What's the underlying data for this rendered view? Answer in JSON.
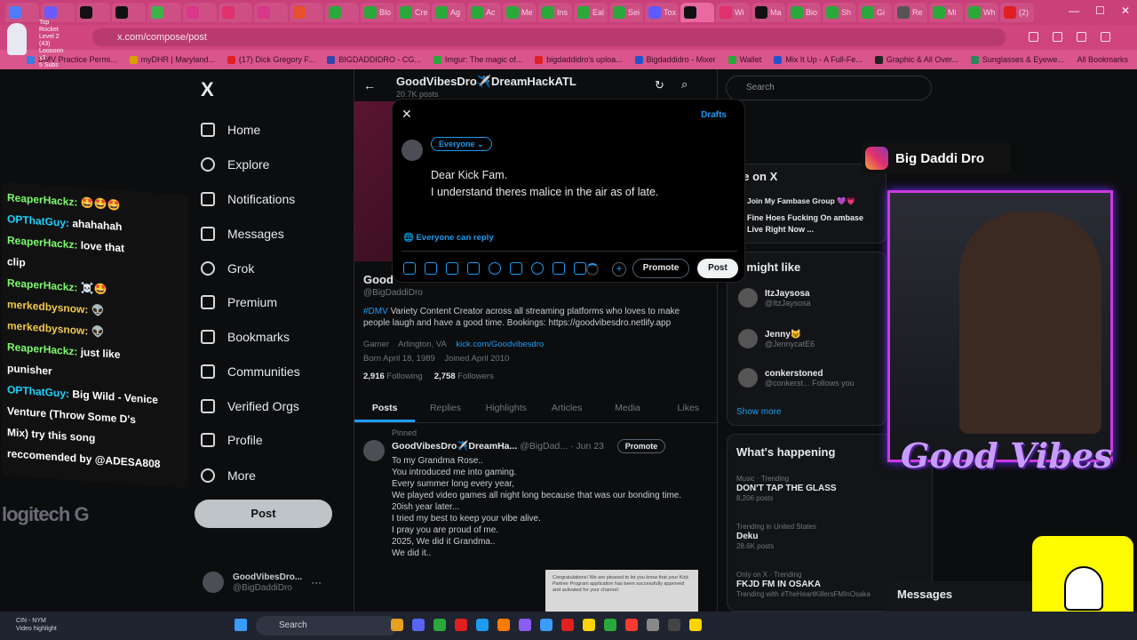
{
  "browser": {
    "tabs": [
      {
        "label": "",
        "color": "#4f7cff"
      },
      {
        "label": "",
        "color": "#6b5bff"
      },
      {
        "label": "",
        "color": "#111"
      },
      {
        "label": "",
        "color": "#111"
      },
      {
        "label": "",
        "color": "#3fb24a"
      },
      {
        "label": "",
        "color": "#d8378a"
      },
      {
        "label": "",
        "color": "#e0306d"
      },
      {
        "label": "",
        "color": "#d8378a"
      },
      {
        "label": "",
        "color": "#e8502c"
      },
      {
        "label": "",
        "color": "#2aa83a"
      },
      {
        "label": "Blo",
        "color": "#2aa83a"
      },
      {
        "label": "Cre",
        "color": "#2aa83a"
      },
      {
        "label": "Ag",
        "color": "#2aa83a"
      },
      {
        "label": "Ac",
        "color": "#2aa83a"
      },
      {
        "label": "Me",
        "color": "#2aa83a"
      },
      {
        "label": "Ins",
        "color": "#2aa83a"
      },
      {
        "label": "Eal",
        "color": "#2aa83a"
      },
      {
        "label": "Sei",
        "color": "#2aa83a"
      },
      {
        "label": "Tox",
        "color": "#5b5bff"
      },
      {
        "label": "",
        "color": "#111"
      },
      {
        "label": "Wi",
        "color": "#e0306d"
      },
      {
        "label": "Ma",
        "color": "#111"
      },
      {
        "label": "Bio",
        "color": "#2aa83a"
      },
      {
        "label": "Sh",
        "color": "#2aa83a"
      },
      {
        "label": "Gi",
        "color": "#2aa83a"
      },
      {
        "label": "Re",
        "color": "#555"
      },
      {
        "label": "Mi",
        "color": "#2aa83a"
      },
      {
        "label": "Wh",
        "color": "#2aa83a"
      },
      {
        "label": "(2)",
        "color": "#e02020"
      }
    ],
    "url": "x.com/compose/post",
    "bookmarks": [
      {
        "label": "DMV Practice Permi...",
        "color": "#3b7ddd"
      },
      {
        "label": "myDHR | Maryland...",
        "color": "#d9a000"
      },
      {
        "label": "(17) Dick Gregory F...",
        "color": "#e02020"
      },
      {
        "label": "BIGDADDIDRO - CG...",
        "color": "#3344aa"
      },
      {
        "label": "Imgur: The magic of...",
        "color": "#2aa83a"
      },
      {
        "label": "bigdaddidro's uploa...",
        "color": "#e02020"
      },
      {
        "label": "Bigdaddidro - Mixer",
        "color": "#2255cc"
      },
      {
        "label": "Wallet",
        "color": "#2aa83a"
      },
      {
        "label": "Mix It Up - A Full-Fe...",
        "color": "#2255cc"
      },
      {
        "label": "Graphic & All Over...",
        "color": "#222"
      },
      {
        "label": "Sunglasses & Eyewe...",
        "color": "#2a8a5a"
      }
    ],
    "all_bookmarks": "All Bookmarks",
    "rocket_overlay": [
      "Top Rocket",
      "Level 2 (43)",
      "Looooon x3",
      "5 Subs"
    ]
  },
  "x_nav": {
    "logo": "X",
    "items": [
      {
        "label": "Home",
        "icon": "home-icon"
      },
      {
        "label": "Explore",
        "icon": "search-icon"
      },
      {
        "label": "Notifications",
        "icon": "bell-icon"
      },
      {
        "label": "Messages",
        "icon": "mail-icon"
      },
      {
        "label": "Grok",
        "icon": "grok-icon"
      },
      {
        "label": "Premium",
        "icon": "x-premium-icon"
      },
      {
        "label": "Bookmarks",
        "icon": "bookmark-icon"
      },
      {
        "label": "Communities",
        "icon": "people-icon"
      },
      {
        "label": "Verified Orgs",
        "icon": "lightning-icon"
      },
      {
        "label": "Profile",
        "icon": "user-icon"
      },
      {
        "label": "More",
        "icon": "more-circle-icon"
      }
    ],
    "post_button": "Post",
    "account": {
      "name": "GoodVibesDro...",
      "handle": "@BigDaddiDro"
    }
  },
  "profile": {
    "title": "GoodVibesDro✈️DreamHackATL",
    "post_count": "20.7K posts",
    "name": "Good",
    "handle": "@BigDaddiDro",
    "bio_tag": "#DMV",
    "bio": " Variety Content Creator across all streaming platforms who loves to make people laugh and have a good time. Bookings: https://goodvibesdro.netlify.app",
    "category": "Gamer",
    "location": "Arlington, VA",
    "link": "kick.com/Goodvibesdro",
    "born": "Born April 18, 1989",
    "joined": "Joined April 2010",
    "following_count": "2,916",
    "following_label": "Following",
    "followers_count": "2,758",
    "followers_label": "Followers",
    "tabs": [
      "Posts",
      "Replies",
      "Highlights",
      "Articles",
      "Media",
      "Likes"
    ],
    "pinned": "Pinned",
    "tweet": {
      "name": "GoodVibesDro✈️DreamHa...",
      "meta": "@BigDad... · Jun 23",
      "promote": "Promote",
      "text": "To my Grandma Rose..\nYou introduced me into gaming.\nEvery summer long every year,\nWe played video games all night long because that was our bonding time.\n20ish year later...\nI tried my best to keep your vibe alive.\nI pray you are proud of me.\n2025, We did it Grandma..\nWe did it..",
      "media_text": "Congratulations! We are pleased to let you know that your Kick Partner Program application has been successfully approved and activated for your channel."
    }
  },
  "right": {
    "search_placeholder": "Search",
    "live_title": "ve on X",
    "live_item_1": "Join My Fambase Group 💜💗",
    "live_item_2": "Fine Hoes Fucking On ambase Live Right Now ...",
    "might_like": "u might like",
    "suggestions": [
      {
        "name": "ItzJaysosa",
        "handle": "@ItzJaysosa"
      },
      {
        "name": "Jenny😺",
        "handle": "@JennycatE6"
      },
      {
        "name": "conkerstoned",
        "handle": "@conkerst... Follows you"
      }
    ],
    "show_more": "Show more",
    "whats_happening": "What's happening",
    "trends": [
      {
        "cat": "Music · Trending",
        "name": "DON'T TAP THE GLASS",
        "count": "8,206 posts"
      },
      {
        "cat": "Trending in United States",
        "name": "Deku",
        "count": "28.6K posts"
      },
      {
        "cat": "Only on X · Trending",
        "name": "FKJD FM IN OSAKA",
        "count": "Trending with #TheHeartKillersFMInOsaka"
      }
    ],
    "messages": "Messages"
  },
  "compose": {
    "close": "✕",
    "drafts": "Drafts",
    "audience": "Everyone ⌄",
    "text_line1": "Dear Kick Fam.",
    "text_line2": "I understand theres malice in the air as of late.",
    "reply_setting": "Everyone can reply",
    "promote": "Promote",
    "post": "Post",
    "tools": [
      "image-icon",
      "gif-icon",
      "grok-icon",
      "poll-icon",
      "emoji-icon",
      "schedule-icon",
      "location-icon",
      "bold-icon",
      "italic-icon"
    ]
  },
  "stream": {
    "chat": [
      {
        "user": "ReaperHackz:",
        "msg": " 🤩🤩🤩",
        "color": "#7dfc6e"
      },
      {
        "user": "OPThatGuy:",
        "msg": " ahahahah",
        "color": "#1bd2ff"
      },
      {
        "user": "ReaperHackz:",
        "msg": " love that",
        "color": "#7dfc6e"
      },
      {
        "user": "",
        "msg": "clip",
        "color": "#fff"
      },
      {
        "user": "ReaperHackz:",
        "msg": " ☠️🤩",
        "color": "#7dfc6e"
      },
      {
        "user": "merkedbysnow:",
        "msg": " 👽",
        "color": "#f2c94c"
      },
      {
        "user": "merkedbysnow:",
        "msg": " 👽",
        "color": "#f2c94c"
      },
      {
        "user": "ReaperHackz:",
        "msg": " just like",
        "color": "#7dfc6e"
      },
      {
        "user": "",
        "msg": "punisher",
        "color": "#fff"
      },
      {
        "user": "OPThatGuy:",
        "msg": " Big Wild - Venice",
        "color": "#1bd2ff"
      },
      {
        "user": "",
        "msg": "Venture (Throw Some D's",
        "color": "#fff"
      },
      {
        "user": "",
        "msg": "Mix) try this song",
        "color": "#fff"
      },
      {
        "user": "",
        "msg": "reccomended by @ADESA808",
        "color": "#fff"
      }
    ],
    "logi": "logitech G",
    "instagram_name": "Big Daddi Dro",
    "good_vibes": "Good Vibes"
  },
  "taskbar": {
    "weather_1": "CIN - NYM",
    "weather_2": "Video highlight",
    "search": "Search"
  }
}
